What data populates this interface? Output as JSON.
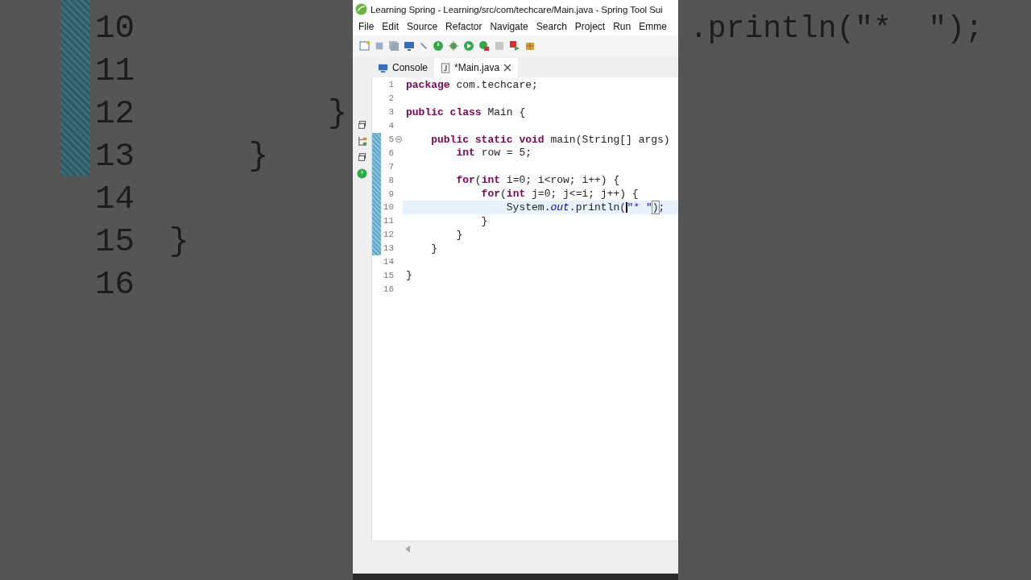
{
  "backdrop_left": [
    {
      "number": "10"
    },
    {
      "number": "11"
    },
    {
      "number": "12",
      "code": "        }"
    },
    {
      "number": "13",
      "code": "    }"
    },
    {
      "number": "14"
    },
    {
      "number": "15",
      "code": "}"
    },
    {
      "number": "16"
    }
  ],
  "backdrop_right": {
    "code": ".println(\"*  \");"
  },
  "window": {
    "title": "Learning Spring - Learning/src/com/techcare/Main.java - Spring Tool Sui"
  },
  "menu": [
    "File",
    "Edit",
    "Source",
    "Refactor",
    "Navigate",
    "Search",
    "Project",
    "Run",
    "Emme"
  ],
  "tabs": [
    {
      "label": "Console",
      "selected": false,
      "closable": false
    },
    {
      "label": "*Main.java",
      "selected": true,
      "closable": true
    }
  ],
  "editor": {
    "lines": [
      {
        "number": "1",
        "changed": false,
        "current": false,
        "tokens": [
          {
            "kind": "keyword",
            "text": "package"
          },
          {
            "kind": "plain",
            "text": " com.techcare;"
          }
        ]
      },
      {
        "number": "2",
        "changed": false,
        "current": false
      },
      {
        "number": "3",
        "changed": false,
        "current": false,
        "tokens": [
          {
            "kind": "keyword",
            "text": "public class"
          },
          {
            "kind": "plain",
            "text": " Main {"
          }
        ]
      },
      {
        "number": "4",
        "changed": false,
        "current": false
      },
      {
        "number": "5",
        "changed": true,
        "current": false,
        "folded": false,
        "tokens": [
          {
            "kind": "keyword",
            "text": "    public static void"
          },
          {
            "kind": "plain",
            "text": " main(String[] args)"
          }
        ]
      },
      {
        "number": "6",
        "changed": true,
        "current": false,
        "tokens": [
          {
            "kind": "keyword",
            "text": "        int"
          },
          {
            "kind": "plain",
            "text": " row = 5;"
          }
        ]
      },
      {
        "number": "7",
        "changed": true,
        "current": false
      },
      {
        "number": "8",
        "changed": true,
        "current": false,
        "tokens": [
          {
            "kind": "keyword",
            "text": "        for"
          },
          {
            "kind": "plain",
            "text": "("
          },
          {
            "kind": "keyword",
            "text": "int"
          },
          {
            "kind": "plain",
            "text": " i=0; i<row; i++) {"
          }
        ]
      },
      {
        "number": "9",
        "changed": true,
        "current": false,
        "tokens": [
          {
            "kind": "keyword",
            "text": "            for"
          },
          {
            "kind": "plain",
            "text": "("
          },
          {
            "kind": "keyword",
            "text": "int"
          },
          {
            "kind": "plain",
            "text": " j=0; j<=i; j++) {"
          }
        ]
      },
      {
        "number": "10",
        "changed": true,
        "current": true,
        "tokens": [
          {
            "kind": "plain",
            "text": "                System."
          },
          {
            "kind": "field",
            "text": "out"
          },
          {
            "kind": "plain",
            "text": ".println("
          },
          {
            "kind": "caret"
          },
          {
            "kind": "string",
            "text": "\"* \""
          },
          {
            "kind": "matched",
            "text": ")"
          },
          {
            "kind": "plain",
            "text": ";"
          }
        ]
      },
      {
        "number": "11",
        "changed": true,
        "current": false,
        "tokens": [
          {
            "kind": "plain",
            "text": "            }"
          }
        ]
      },
      {
        "number": "12",
        "changed": true,
        "current": false,
        "tokens": [
          {
            "kind": "plain",
            "text": "        }"
          }
        ]
      },
      {
        "number": "13",
        "changed": true,
        "current": false,
        "tokens": [
          {
            "kind": "plain",
            "text": "    }"
          }
        ]
      },
      {
        "number": "14",
        "changed": false,
        "current": false
      },
      {
        "number": "15",
        "changed": false,
        "current": false,
        "tokens": [
          {
            "kind": "plain",
            "text": "}"
          }
        ]
      },
      {
        "number": "16",
        "changed": false,
        "current": false
      }
    ]
  }
}
